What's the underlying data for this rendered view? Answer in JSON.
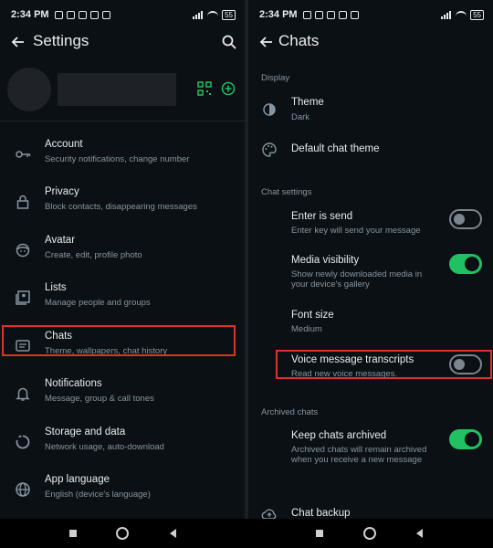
{
  "left": {
    "status_time": "2:34 PM",
    "battery": "55",
    "title": "Settings",
    "items": [
      {
        "label": "Account",
        "sub": "Security notifications, change number",
        "icon": "key-icon"
      },
      {
        "label": "Privacy",
        "sub": "Block contacts, disappearing messages",
        "icon": "lock-icon"
      },
      {
        "label": "Avatar",
        "sub": "Create, edit, profile photo",
        "icon": "avatar-face-icon"
      },
      {
        "label": "Lists",
        "sub": "Manage people and groups",
        "icon": "lists-icon"
      },
      {
        "label": "Chats",
        "sub": "Theme, wallpapers, chat history",
        "icon": "chat-icon"
      },
      {
        "label": "Notifications",
        "sub": "Message, group & call tones",
        "icon": "bell-icon"
      },
      {
        "label": "Storage and data",
        "sub": "Network usage, auto-download",
        "icon": "data-circle-icon"
      },
      {
        "label": "App language",
        "sub": "English (device's language)",
        "icon": "globe-icon"
      }
    ]
  },
  "right": {
    "status_time": "2:34 PM",
    "battery": "55",
    "title": "Chats",
    "display_header": "Display",
    "theme_label": "Theme",
    "theme_value": "Dark",
    "default_theme_label": "Default chat theme",
    "chat_settings_header": "Chat settings",
    "enter_send_label": "Enter is send",
    "enter_send_sub": "Enter key will send your message",
    "enter_send_on": false,
    "media_label": "Media visibility",
    "media_sub": "Show newly downloaded media in your device's gallery",
    "media_on": true,
    "font_label": "Font size",
    "font_value": "Medium",
    "voice_label": "Voice message transcripts",
    "voice_sub": "Read new voice messages.",
    "voice_on": false,
    "archived_header": "Archived chats",
    "keep_label": "Keep chats archived",
    "keep_sub": "Archived chats will remain archived when you receive a new message",
    "keep_on": true,
    "backup_label": "Chat backup"
  },
  "colors": {
    "accent": "#21c063",
    "highlight": "#e0312b",
    "background": "#0b1014"
  }
}
